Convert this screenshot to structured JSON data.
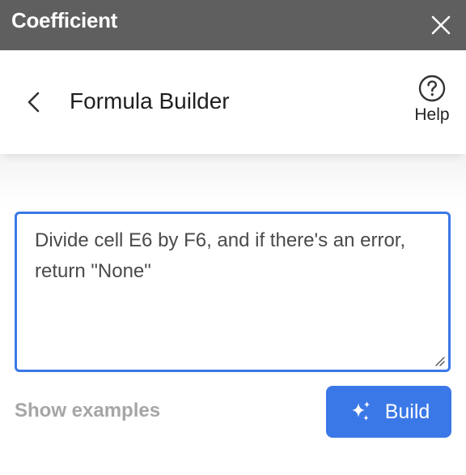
{
  "app": {
    "title": "Coefficient"
  },
  "header": {
    "title": "Formula Builder",
    "help_label": "Help"
  },
  "prompt": {
    "value": "Divide cell E6 by F6, and if there's an error, return \"None\""
  },
  "actions": {
    "show_examples_label": "Show examples",
    "build_label": "Build"
  },
  "colors": {
    "accent": "#3b78e7",
    "titlebar": "#5f5f5f",
    "muted_text": "#a6a6a6"
  },
  "icons": {
    "close": "close-icon",
    "back": "chevron-left-icon",
    "help": "help-circle-icon",
    "build": "sparkle-icon",
    "resize": "resize-grip-icon"
  }
}
